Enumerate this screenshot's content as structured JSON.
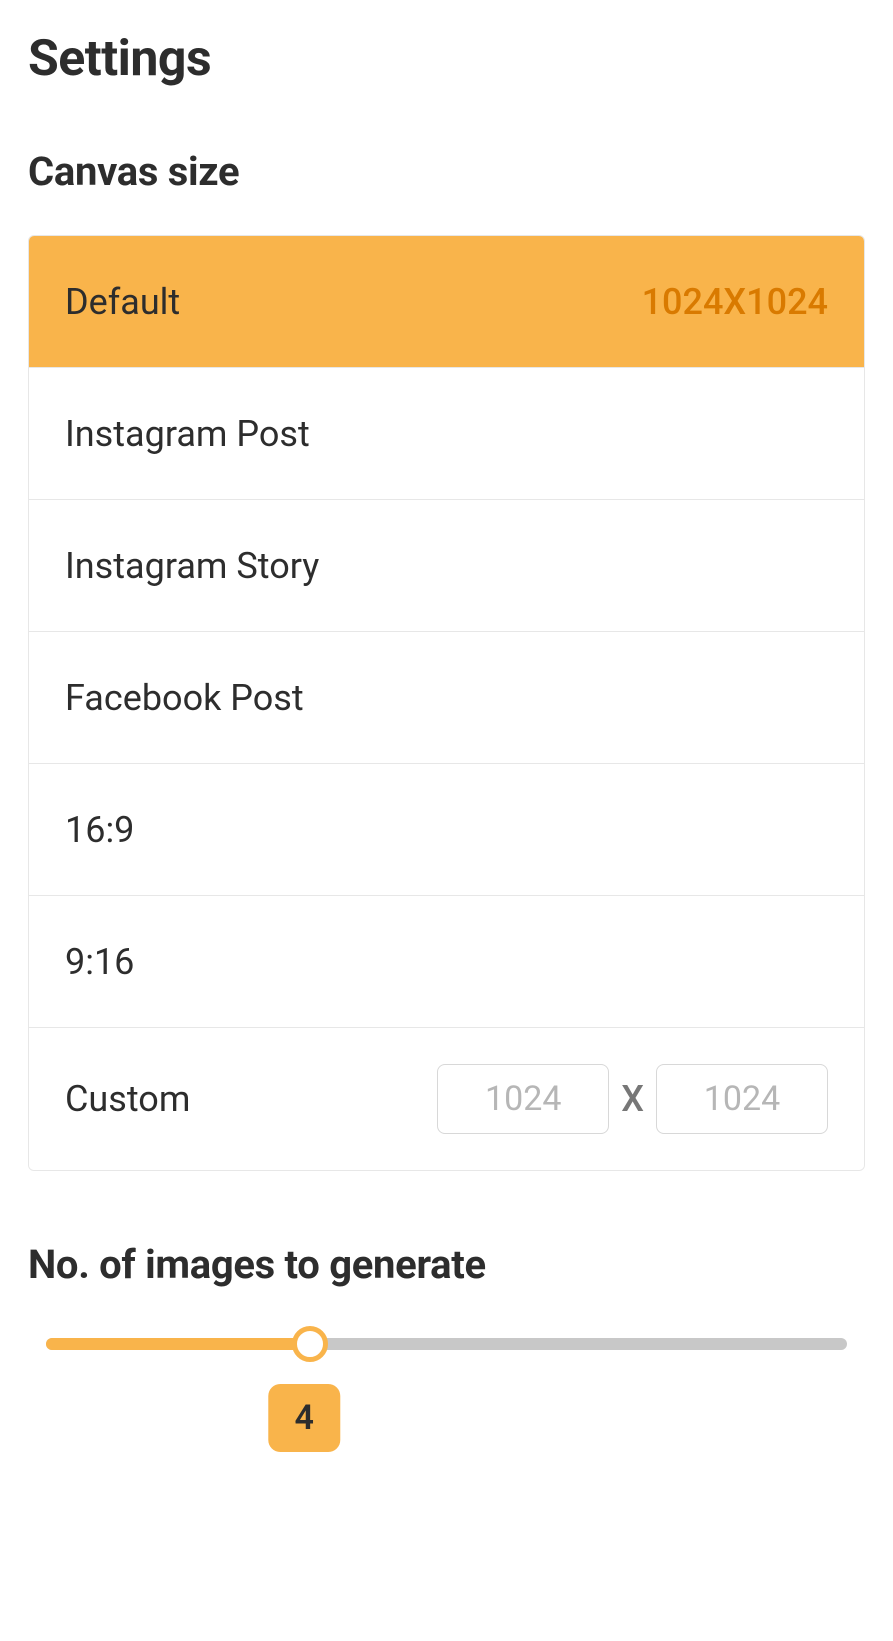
{
  "settings": {
    "title": "Settings"
  },
  "canvas": {
    "title": "Canvas size",
    "options": [
      {
        "label": "Default",
        "dim": "1024X1024",
        "selected": true
      },
      {
        "label": "Instagram Post",
        "dim": "",
        "selected": false
      },
      {
        "label": "Instagram Story",
        "dim": "",
        "selected": false
      },
      {
        "label": "Facebook Post",
        "dim": "",
        "selected": false
      },
      {
        "label": "16:9",
        "dim": "",
        "selected": false
      },
      {
        "label": "9:16",
        "dim": "",
        "selected": false
      }
    ],
    "custom": {
      "label": "Custom",
      "width_placeholder": "1024",
      "height_placeholder": "1024",
      "separator": "X"
    }
  },
  "images": {
    "title": "No. of images to generate",
    "value": 4,
    "min": 1,
    "max": 10,
    "percent": 33
  },
  "colors": {
    "accent": "#f9b44b",
    "accent_text": "#d97a00"
  }
}
